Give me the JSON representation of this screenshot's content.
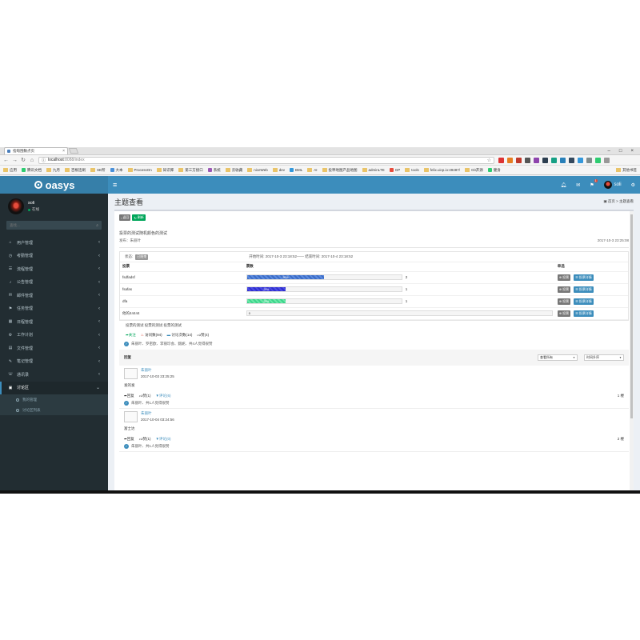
{
  "browser": {
    "tab_title": "指甸围数点页",
    "url_host": "localhost",
    "url_path": ":8088/index",
    "bookmarks": [
      "应用",
      "腾讯文档",
      "九月",
      "百根连刷",
      "SE所",
      "大本",
      "ProcessOn",
      "知识库",
      "第三方接口",
      "系统",
      "云收藏",
      "niceWeb",
      "dev",
      "BML",
      "AI",
      "投秤地图产品地图",
      "adminLTE",
      "GP",
      "tools",
      "felix.uicp.io:49487/",
      "Git开源",
      "健身"
    ],
    "bookmarks_more": "其他书签"
  },
  "app": {
    "brand": "oasys",
    "user_name": "soli",
    "notify_count": "1",
    "sidebar": {
      "user_name": "soli",
      "status": "在线",
      "search_placeholder": "查找...",
      "items": [
        {
          "icon": "⌂",
          "label": "用户管理"
        },
        {
          "icon": "◷",
          "label": "考勤管理"
        },
        {
          "icon": "☰",
          "label": "流程管理"
        },
        {
          "icon": "♪",
          "label": "公告管理"
        },
        {
          "icon": "✉",
          "label": "邮件管理"
        },
        {
          "icon": "⚑",
          "label": "任务管理"
        },
        {
          "icon": "▦",
          "label": "日程管理"
        },
        {
          "icon": "⚙",
          "label": "工作计划"
        },
        {
          "icon": "▤",
          "label": "文件管理"
        },
        {
          "icon": "✎",
          "label": "笔记管理"
        },
        {
          "icon": "☏",
          "label": "通讯录"
        }
      ],
      "open_item": {
        "icon": "▣",
        "label": "讨论区"
      },
      "sub_items": [
        "我的管理",
        "讨论区列表"
      ]
    },
    "page": {
      "title": "主题查看",
      "breadcrumb": "首页 > 主题查看",
      "back_label": "返回",
      "refresh_label": "刷新",
      "topic_title": "投票的测试随机颜色的测试",
      "publisher_label": "发布：",
      "publisher": "朱丽叶",
      "publish_date": "2017-10-3 23:25:08",
      "vote": {
        "status_label": "状态:",
        "status": "已结束",
        "time_range": "开始时间: 2017-10-3 23:18:52—— 结束时间: 2017-10-4 23:18:52",
        "headers": {
          "option": "投票",
          "count": "票数",
          "type": "单选"
        },
        "vote_btn": "投票",
        "detail_btn": "投票详情",
        "options": [
          {
            "name": "fsdfadsf",
            "percent": "50%",
            "fraction": 0.5,
            "count": "2",
            "style": "stripe1"
          },
          {
            "name": "fsafas",
            "percent": "25%",
            "fraction": 0.25,
            "count": "1",
            "style": "stripe2"
          },
          {
            "name": "dfa",
            "percent": "25%",
            "fraction": 0.25,
            "count": "1",
            "style": "stripe3"
          },
          {
            "name": "他的44444",
            "percent": "",
            "fraction": 0,
            "count": "0",
            "style": "stripe1"
          }
        ]
      },
      "description": "投票的测试 投票的测试 投票的测试",
      "stats": {
        "follow": "关注",
        "visits": "访问数(94)",
        "comments": "讨论次数(14)",
        "likes": "赞(4)"
      },
      "likers": "朱丽叶、罗密欧、李丽珍会、甄妮、共4人觉得很赞",
      "reply": {
        "title": "回复",
        "sort1": "查看所有",
        "sort2": "时间升序"
      },
      "replies": [
        {
          "author": "朱丽叶",
          "date": "2017-10-03 23:25:25",
          "text": "发的发",
          "reply_label": "回复",
          "like_label": "赞(1)",
          "comments": "评论(6)",
          "floor": "1 楼",
          "likes": "朱丽叶、共1人觉得很赞"
        },
        {
          "author": "朱丽叶",
          "date": "2017-10-04 03:24:56",
          "text": "富士达",
          "reply_label": "回复",
          "like_label": "赞(1)",
          "comments": "评论(0)",
          "floor": "2 楼",
          "likes": "朱丽叶、共1人觉得很赞"
        }
      ]
    }
  }
}
